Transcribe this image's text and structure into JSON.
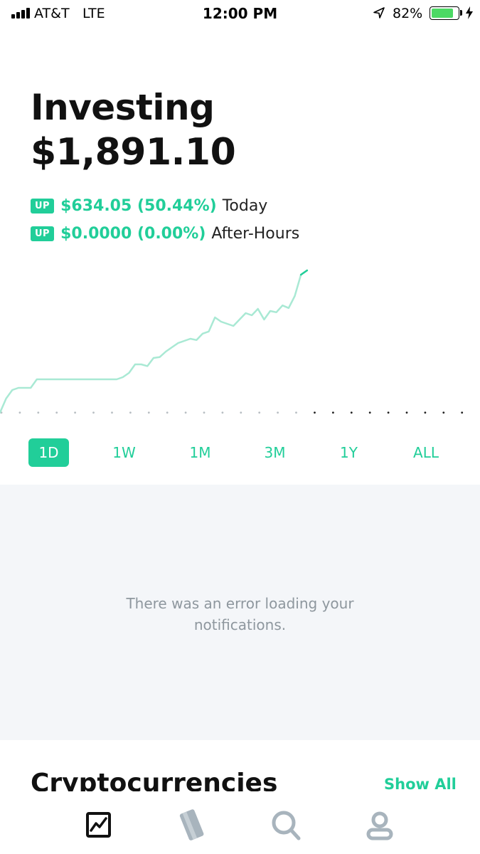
{
  "status_bar": {
    "carrier": "AT&T",
    "network": "LTE",
    "time": "12:00 PM",
    "battery_percent": "82%",
    "battery_level": 0.82,
    "battery_color": "#4cd964"
  },
  "header": {
    "title": "Investing",
    "portfolio_value": "$1,891.10"
  },
  "changes": [
    {
      "badge": "UP",
      "value": "$634.05 (50.44%)",
      "label": "Today"
    },
    {
      "badge": "UP",
      "value": "$0.0000 (0.00%)",
      "label": "After-Hours"
    }
  ],
  "range_tabs": [
    {
      "label": "1D",
      "active": true
    },
    {
      "label": "1W",
      "active": false
    },
    {
      "label": "1M",
      "active": false
    },
    {
      "label": "3M",
      "active": false
    },
    {
      "label": "1Y",
      "active": false
    },
    {
      "label": "ALL",
      "active": false
    }
  ],
  "notifications": {
    "error_line1": "There was an error loading your",
    "error_line2": "notifications."
  },
  "crypto": {
    "heading": "Cryptocurrencies",
    "show_all": "Show All"
  },
  "bottom_nav": [
    {
      "icon": "portfolio-chart-icon",
      "active": true
    },
    {
      "icon": "cash-card-icon",
      "active": false
    },
    {
      "icon": "search-icon",
      "active": false
    },
    {
      "icon": "account-icon",
      "active": false
    }
  ],
  "colors": {
    "accent": "#21ce99",
    "chart_line": "#a9e9d4",
    "panel_bg": "#f4f6f9",
    "muted_text": "#8e979e"
  },
  "chart_data": {
    "type": "line",
    "series": [
      {
        "values": [
          1257,
          1290,
          1310,
          1315,
          1315,
          1315,
          1335,
          1335,
          1335,
          1335,
          1335,
          1335,
          1335,
          1335,
          1335,
          1335,
          1335,
          1335,
          1335,
          1335,
          1340,
          1350,
          1370,
          1370,
          1366,
          1385,
          1387,
          1400,
          1410,
          1420,
          1425,
          1430,
          1427,
          1442,
          1447,
          1480,
          1470,
          1465,
          1460,
          1475,
          1490,
          1485,
          1500,
          1475,
          1495,
          1492,
          1508,
          1502,
          1530,
          1580,
          1590
        ]
      }
    ],
    "x_count": 78,
    "after_hours_start_index": 51,
    "ylim": [
      1240,
      1640
    ],
    "baseline": 1257,
    "grid": false
  }
}
